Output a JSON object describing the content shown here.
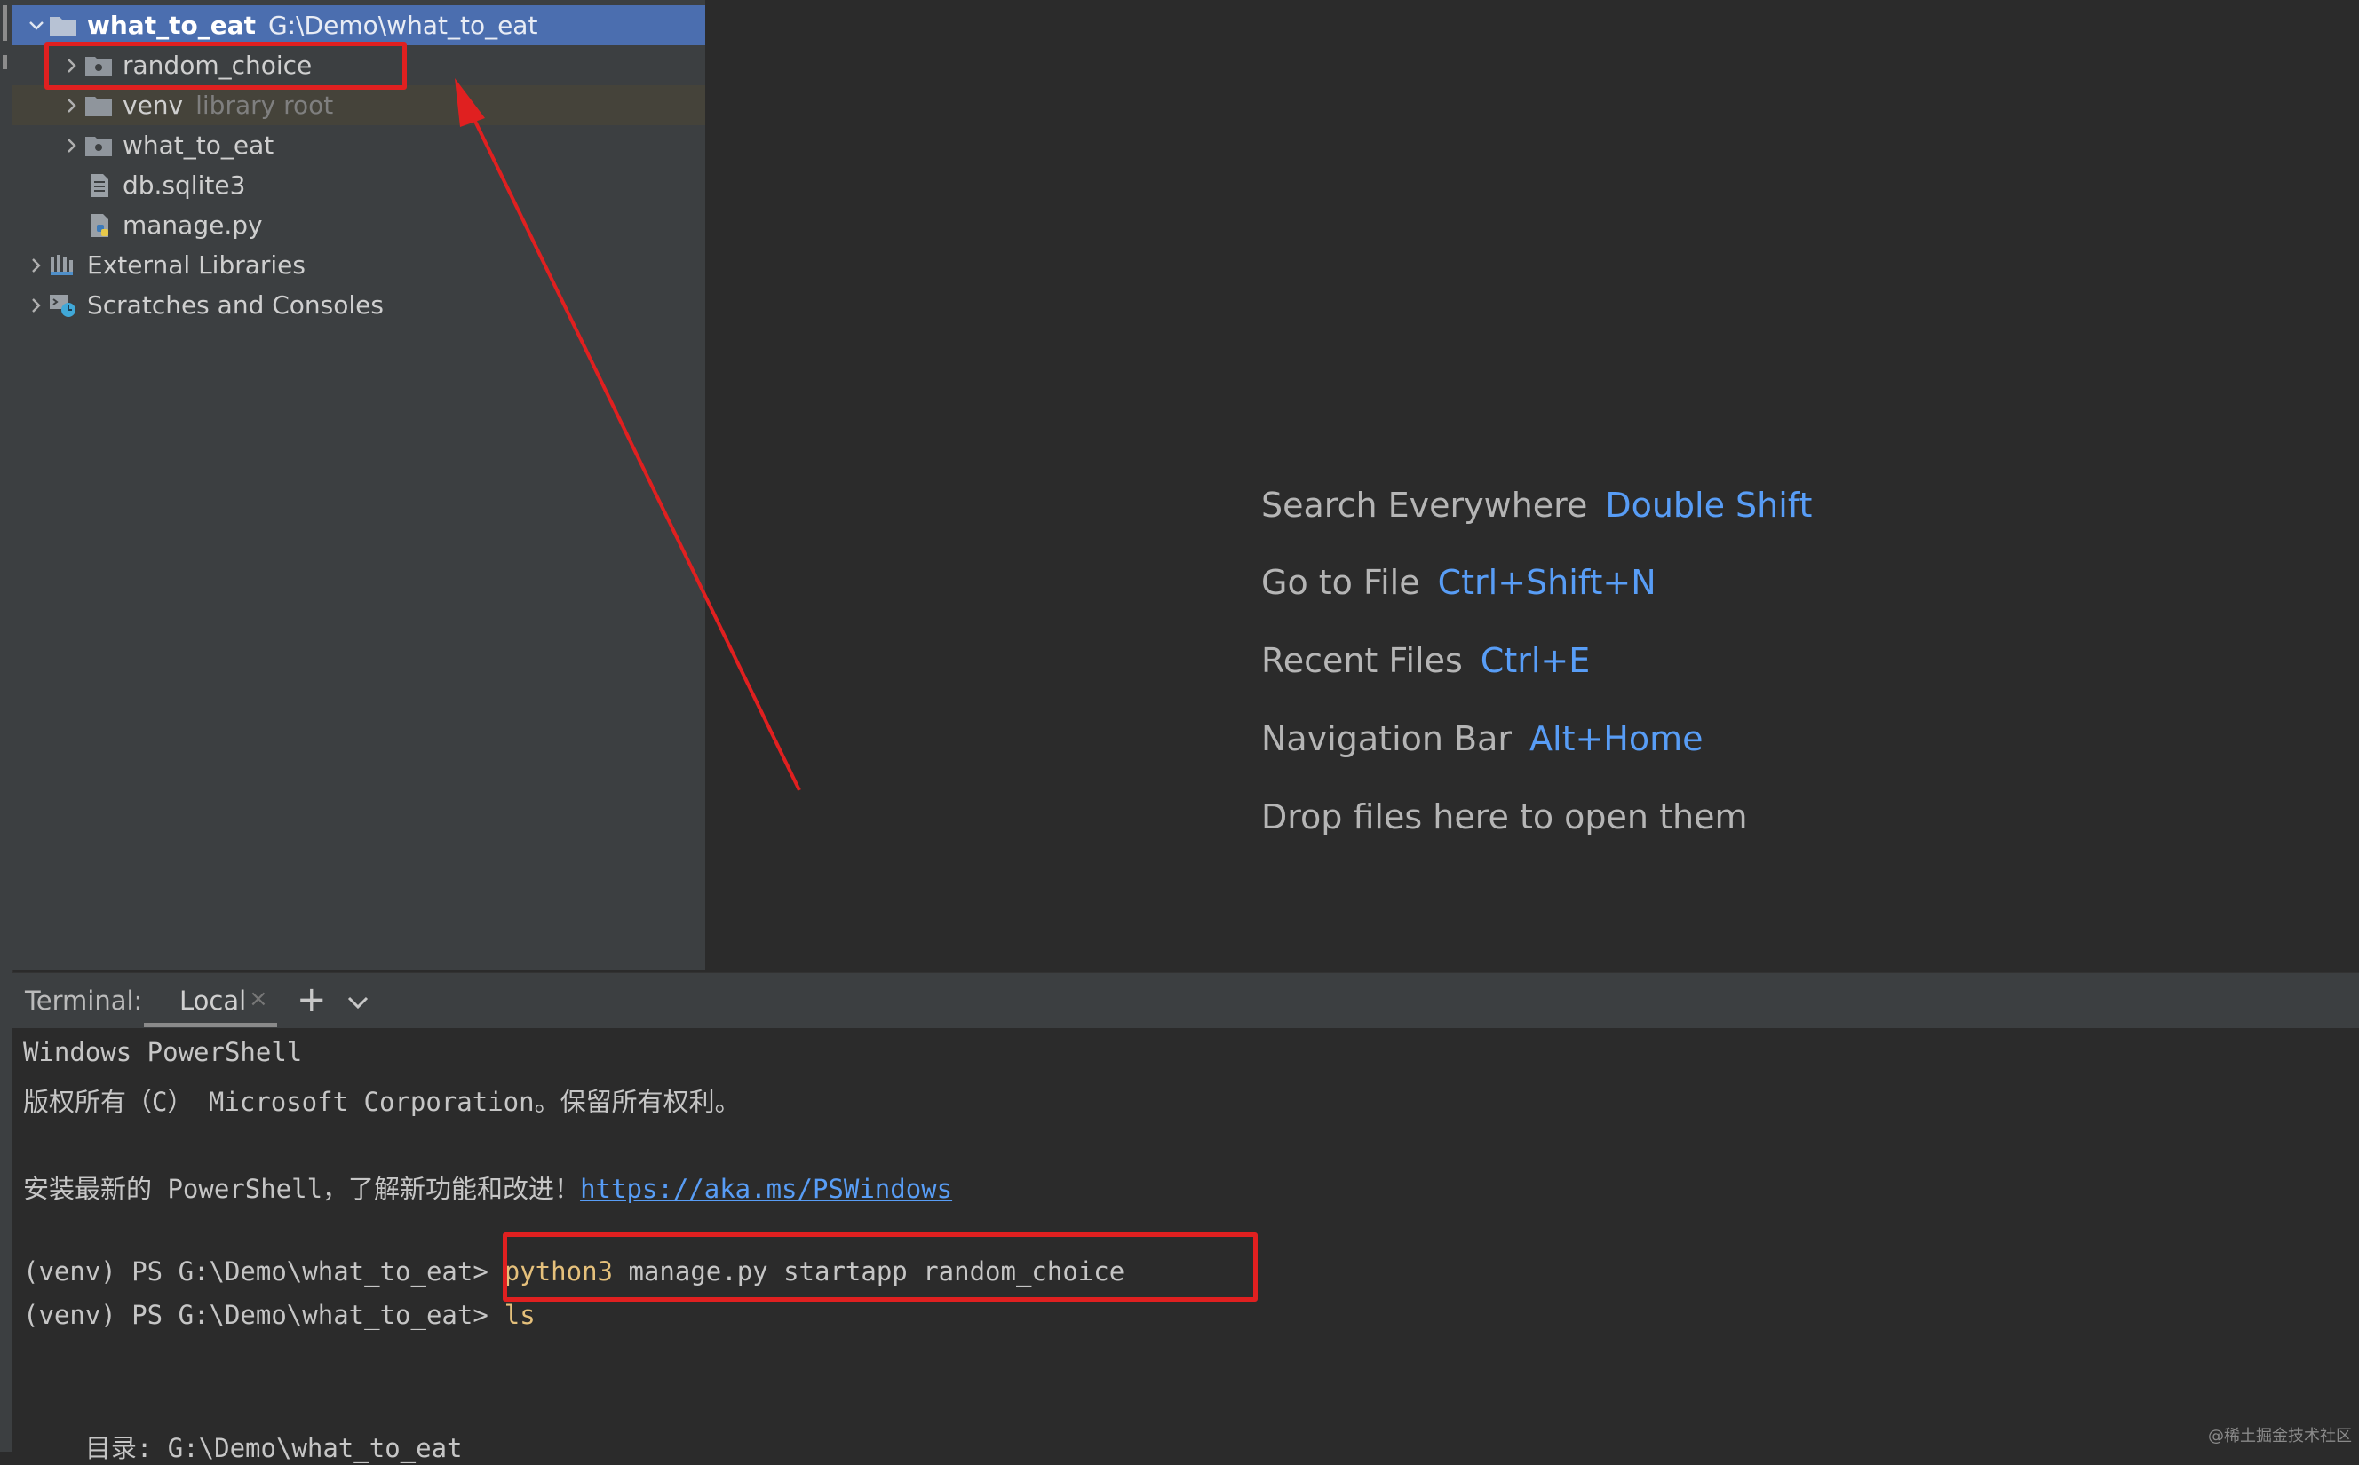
{
  "project_tree": {
    "root": {
      "name": "what_to_eat",
      "path": "G:\\Demo\\what_to_eat"
    },
    "items": [
      {
        "label": "random_choice",
        "kind": "package-folder"
      },
      {
        "label": "venv",
        "note": "library root",
        "kind": "folder"
      },
      {
        "label": "what_to_eat",
        "kind": "package-folder"
      },
      {
        "label": "db.sqlite3",
        "kind": "database-file"
      },
      {
        "label": "manage.py",
        "kind": "python-file"
      },
      {
        "label": "External Libraries",
        "kind": "libraries"
      },
      {
        "label": "Scratches and Consoles",
        "kind": "scratches"
      }
    ]
  },
  "editor_hints": [
    {
      "label": "Search Everywhere",
      "shortcut": "Double Shift"
    },
    {
      "label": "Go to File",
      "shortcut": "Ctrl+Shift+N"
    },
    {
      "label": "Recent Files",
      "shortcut": "Ctrl+E"
    },
    {
      "label": "Navigation Bar",
      "shortcut": "Alt+Home"
    },
    {
      "label": "Drop files here to open them",
      "shortcut": ""
    }
  ],
  "terminal": {
    "title": "Terminal:",
    "tab": "Local",
    "close_glyph": "×",
    "add_glyph": "+",
    "lines": {
      "l1": "Windows PowerShell",
      "l2": "版权所有（C） Microsoft Corporation。保留所有权利。",
      "l3_text": "安装最新的 PowerShell，了解新功能和改进！",
      "l3_link": "https://aka.ms/PSWindows",
      "prompt": "(venv) PS G:\\Demo\\what_to_eat>",
      "cmd1_keyword": "python3",
      "cmd1_rest": " manage.py startapp random_choice",
      "cmd2": "ls",
      "dir_line": "    目录: G:\\Demo\\what_to_eat"
    }
  },
  "watermark": "@稀土掘金技术社区",
  "colors": {
    "selection": "#4b6eaf",
    "shortcut": "#589df6",
    "annotation": "#e02020",
    "command": "#e5c07b"
  }
}
